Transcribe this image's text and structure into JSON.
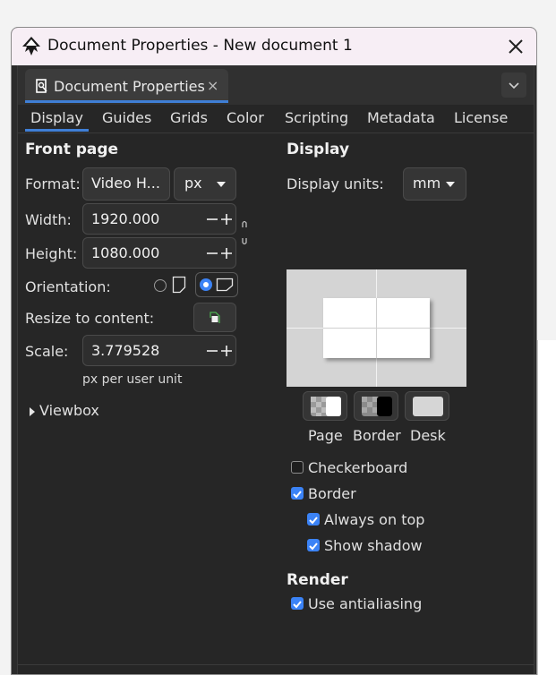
{
  "window": {
    "title": "Document Properties - New document 1"
  },
  "dock": {
    "tab_label": "Document Properties",
    "tab_close": "×"
  },
  "tabs": [
    {
      "label": "Display",
      "active": true
    },
    {
      "label": "Guides"
    },
    {
      "label": "Grids"
    },
    {
      "label": "Color"
    },
    {
      "label": "Scripting"
    },
    {
      "label": "Metadata"
    },
    {
      "label": "License"
    }
  ],
  "front_page": {
    "heading": "Front page",
    "format_label": "Format:",
    "format_value": "Video H...",
    "unit_value": "px",
    "width_label": "Width:",
    "width_value": "1920.000",
    "height_label": "Height:",
    "height_value": "1080.000",
    "orientation_label": "Orientation:",
    "resize_label": "Resize to content:",
    "scale_label": "Scale:",
    "scale_value": "3.779528",
    "scale_unit": "px per user unit",
    "viewbox_label": "Viewbox"
  },
  "display": {
    "heading": "Display",
    "units_label": "Display units:",
    "units_value": "mm",
    "swatch_labels": [
      "Page",
      "Border",
      "Desk"
    ],
    "checkerboard_label": "Checkerboard",
    "checkerboard": false,
    "border_label": "Border",
    "border": true,
    "always_on_top_label": "Always on top",
    "always_on_top": true,
    "show_shadow_label": "Show shadow",
    "show_shadow": true
  },
  "render": {
    "heading": "Render",
    "antialias_label": "Use antialiasing",
    "antialias": true
  },
  "colors": {
    "accent": "#3b83f6",
    "tab_underline": "#3f7fd6",
    "titlebar_bg": "#f7eef5",
    "panel_bg": "#262626"
  },
  "icons": {
    "app": "inkscape-icon",
    "close": "close-icon",
    "dock_menu": "chevron-down-icon",
    "link": "chain-link-icon",
    "resize": "resize-to-content-icon",
    "viewbox_expander": "triangle-right-icon"
  }
}
